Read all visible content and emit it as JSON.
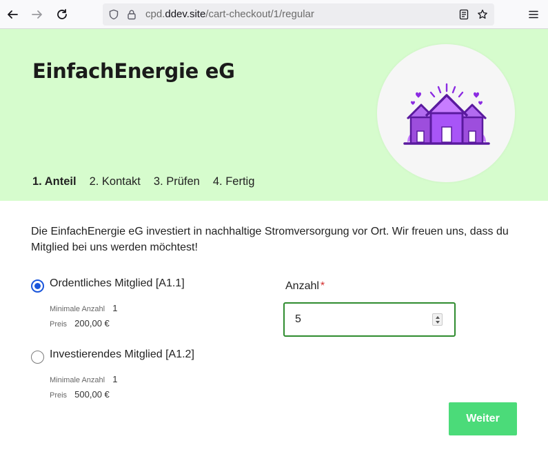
{
  "browser": {
    "url_prefix": "cpd.",
    "url_domain": "ddev.site",
    "url_path": "/cart-checkout/1/regular",
    "icons": [
      "back-icon",
      "forward-icon",
      "reload-icon",
      "shield-icon",
      "lock-icon",
      "reader-mode-icon",
      "bookmark-star-icon",
      "menu-icon"
    ]
  },
  "header": {
    "org_name": "EinfachEnergie eG",
    "bg_color": "#d6fccd",
    "logo_icon": "houses-logo-icon",
    "steps": [
      {
        "label": "1. Anteil",
        "active": true
      },
      {
        "label": "2. Kontakt",
        "active": false
      },
      {
        "label": "3. Prüfen",
        "active": false
      },
      {
        "label": "4. Fertig",
        "active": false
      }
    ]
  },
  "intro": "Die EinfachEnergie eG investiert in nachhaltige Stromversorgung vor Ort. Wir freuen uns, dass du Mitglied bei uns werden möchtest!",
  "options": [
    {
      "label": "Ordentliches Mitglied [A1.1]",
      "checked": true,
      "min_key": "Minimale Anzahl",
      "min_value": "1",
      "price_key": "Preis",
      "price_value": "200,00 €"
    },
    {
      "label": "Investierendes Mitglied [A1.2]",
      "checked": false,
      "min_key": "Minimale Anzahl",
      "min_value": "1",
      "price_key": "Preis",
      "price_value": "500,00 €"
    }
  ],
  "quantity": {
    "label": "Anzahl",
    "required_mark": "*",
    "value": "5"
  },
  "submit": {
    "label": "Weiter",
    "color": "#4bdb79"
  }
}
